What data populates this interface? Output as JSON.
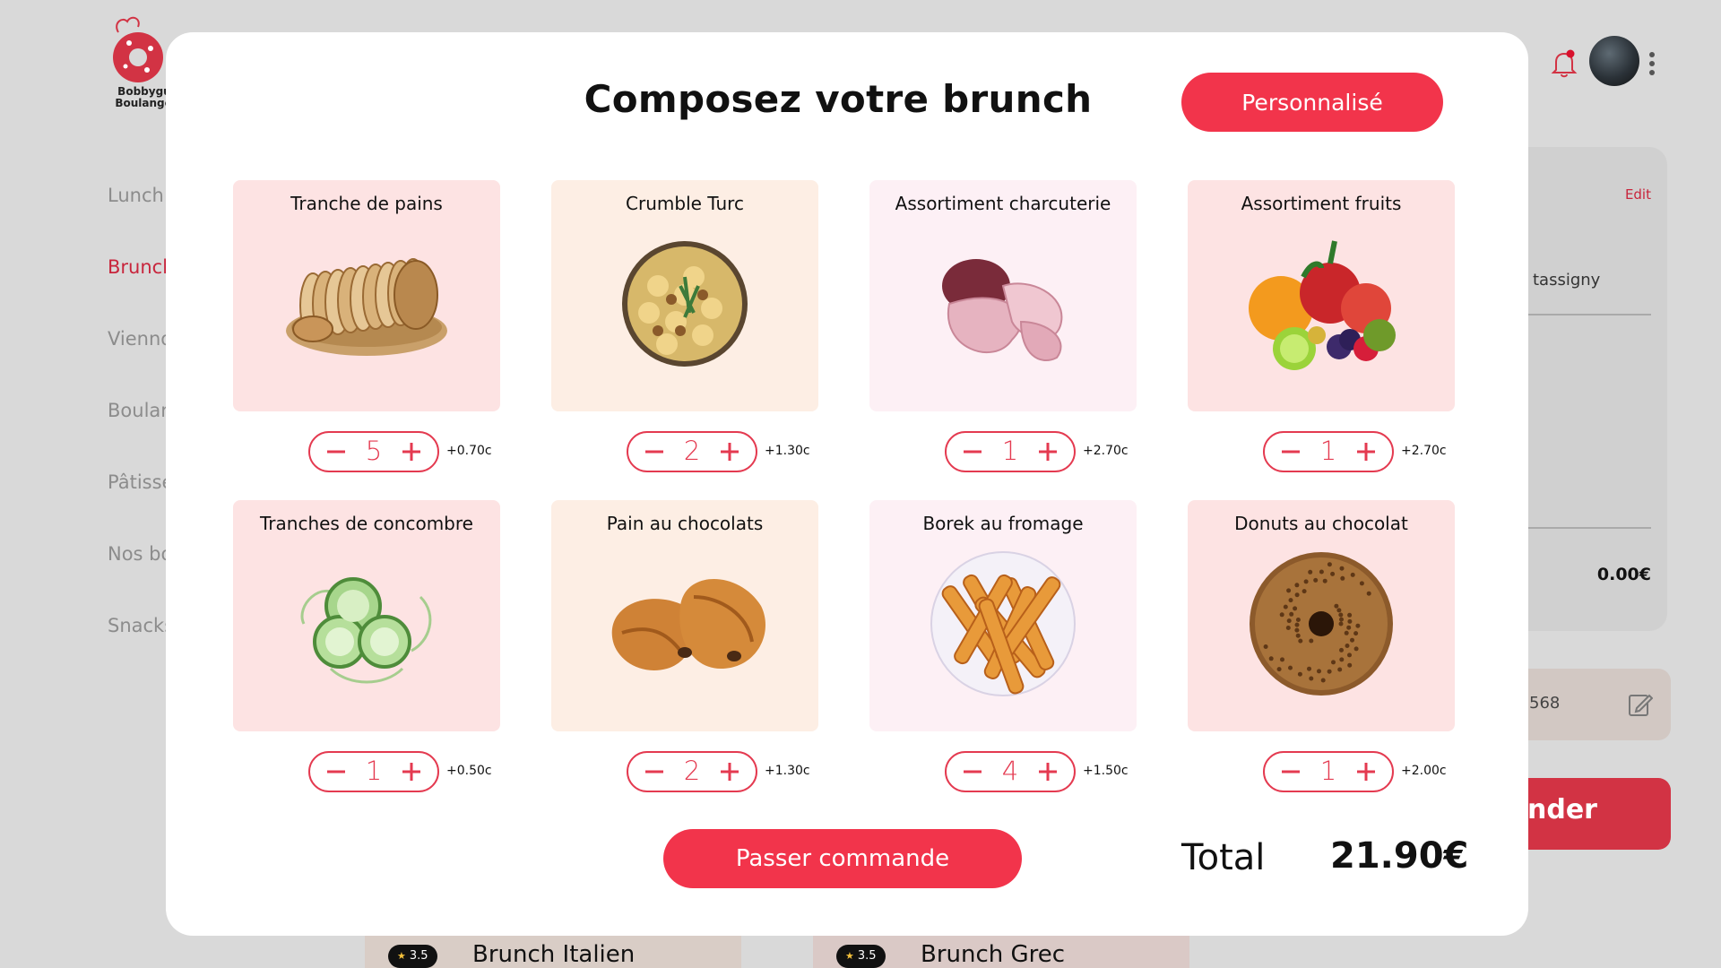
{
  "app": {
    "logo_text_line1": "Bobbygui",
    "logo_text_line2": "Boulanger"
  },
  "sidebar": {
    "items": [
      {
        "label": "Lunch"
      },
      {
        "label": "Brunch"
      },
      {
        "label": "Vienno"
      },
      {
        "label": "Boular"
      },
      {
        "label": "Pâtisse"
      },
      {
        "label": "Nos bo"
      },
      {
        "label": "Snacks"
      }
    ]
  },
  "cart": {
    "edit_label": "Edit",
    "address": "tassigny",
    "total": "0.00€",
    "phone": "568",
    "order_label": "nder"
  },
  "background_cards": [
    {
      "rating": "3.5",
      "name": "Brunch Italien"
    },
    {
      "rating": "3.5",
      "name": "Brunch Grec"
    }
  ],
  "modal": {
    "title": "Composez votre brunch",
    "custom_button": "Personnalisé",
    "order_button": "Passer commande",
    "total_label": "Total",
    "total_value": "21.90€",
    "items": [
      {
        "name": "Tranche de pains",
        "qty": "5",
        "price": "+0.70c",
        "bg": "#fde3e3",
        "icon": "bread-icon"
      },
      {
        "name": "Crumble Turc",
        "qty": "2",
        "price": "+1.30c",
        "bg": "#fdeee4",
        "icon": "crumble-icon"
      },
      {
        "name": "Assortiment charcuterie",
        "qty": "1",
        "price": "+2.70c",
        "bg": "#fdf0f5",
        "icon": "charcuterie-icon"
      },
      {
        "name": "Assortiment fruits",
        "qty": "1",
        "price": "+2.70c",
        "bg": "#fde3e3",
        "icon": "fruits-icon"
      },
      {
        "name": "Tranches de concombre",
        "qty": "1",
        "price": "+0.50c",
        "bg": "#fde3e3",
        "icon": "cucumber-icon"
      },
      {
        "name": "Pain au chocolats",
        "qty": "2",
        "price": "+1.30c",
        "bg": "#fdeee4",
        "icon": "pain-chocolat-icon"
      },
      {
        "name": "Borek au fromage",
        "qty": "4",
        "price": "+1.50c",
        "bg": "#fdf0f5",
        "icon": "borek-icon"
      },
      {
        "name": "Donuts au chocolat",
        "qty": "1",
        "price": "+2.00c",
        "bg": "#fde3e3",
        "icon": "donut-icon"
      }
    ]
  }
}
